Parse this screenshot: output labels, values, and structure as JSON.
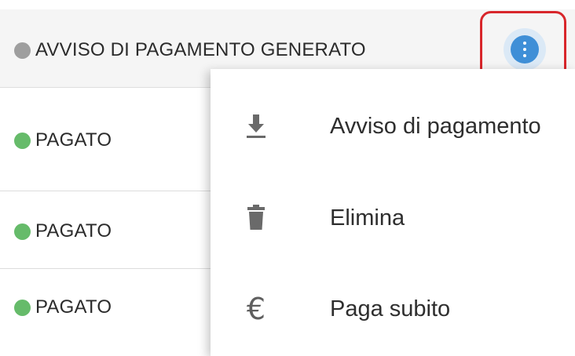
{
  "rows": [
    {
      "status": "AVVISO DI PAGAMENTO GENERATO",
      "dot_color": "#9e9e9e"
    },
    {
      "status": "PAGATO",
      "dot_color": "#66bb6a"
    },
    {
      "status": "PAGATO",
      "dot_color": "#66bb6a"
    },
    {
      "status": "PAGATO",
      "dot_color": "#66bb6a"
    }
  ],
  "kebab": {
    "icon": "more-vert-icon",
    "highlight_color": "#d8262b",
    "color": "#3f8fd7"
  },
  "menu": {
    "items": [
      {
        "label": "Avviso di pagamento",
        "icon": "download-icon"
      },
      {
        "label": "Elimina",
        "icon": "trash-icon"
      },
      {
        "label": "Paga subito",
        "icon": "euro-icon",
        "glyph": "€"
      }
    ]
  }
}
